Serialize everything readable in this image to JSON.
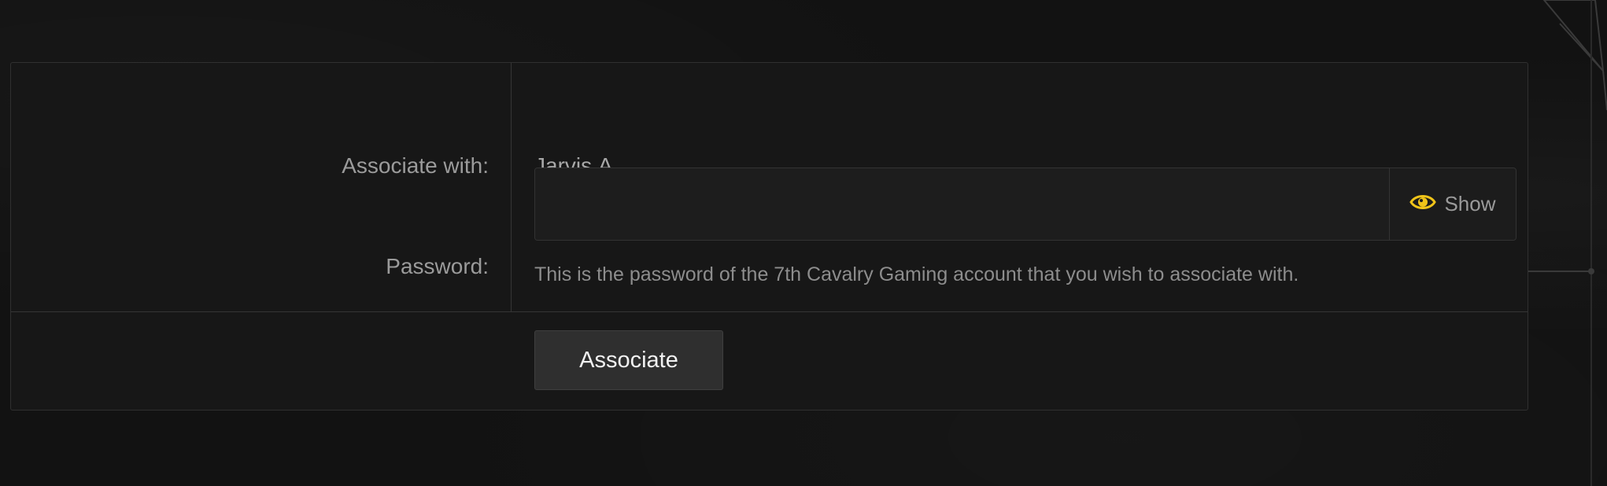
{
  "form": {
    "associate_label": "Associate with:",
    "associate_value": "Jarvis.A",
    "password_label": "Password:",
    "password_value": "",
    "show_label": "Show",
    "explain_text": "This is the password of the 7th Cavalry Gaming account that you wish to associate with.",
    "submit_label": "Associate"
  },
  "icons": {
    "show": "eye-icon"
  },
  "colors": {
    "accent": "#f0c419",
    "background": "#121212",
    "panel": "#171717"
  }
}
